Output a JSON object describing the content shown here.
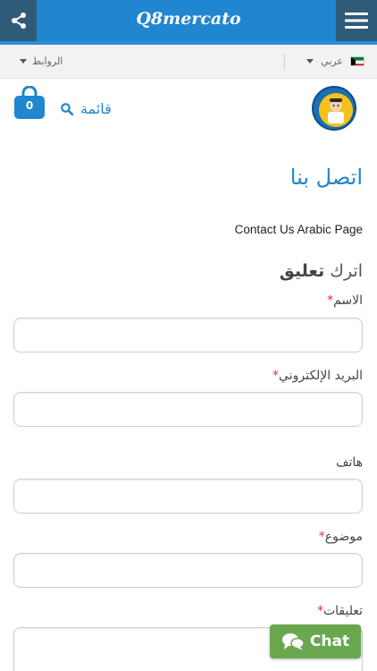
{
  "topbar": {
    "brand": "Q8mercato",
    "share_icon": "share-icon",
    "menu_icon": "hamburger-menu-icon",
    "color": "#1f86cf"
  },
  "subbar": {
    "links_label": "الروابط",
    "language_label": "عربي",
    "flag_icon": "kuwait-flag-icon"
  },
  "header": {
    "cart_count": "0",
    "search_label": "قائمة",
    "logo_icon": "store-logo"
  },
  "main": {
    "title": "اتصل بنا",
    "page_text": "Contact Us Arabic  Page",
    "leave_prefix": "اترك",
    "leave_bold": "تعليق"
  },
  "form": {
    "fields": [
      {
        "label": "الاسم",
        "required": true
      },
      {
        "label": "البريد الإلكتروني",
        "required": true
      },
      {
        "label": "هاتف",
        "required": false
      },
      {
        "label": "موضوع",
        "required": true
      },
      {
        "label": "تعليقات",
        "required": true
      }
    ],
    "required_mark": "*"
  },
  "chat": {
    "label": "Chat",
    "icon": "chat-bubbles-icon",
    "color": "#6aa84f"
  }
}
